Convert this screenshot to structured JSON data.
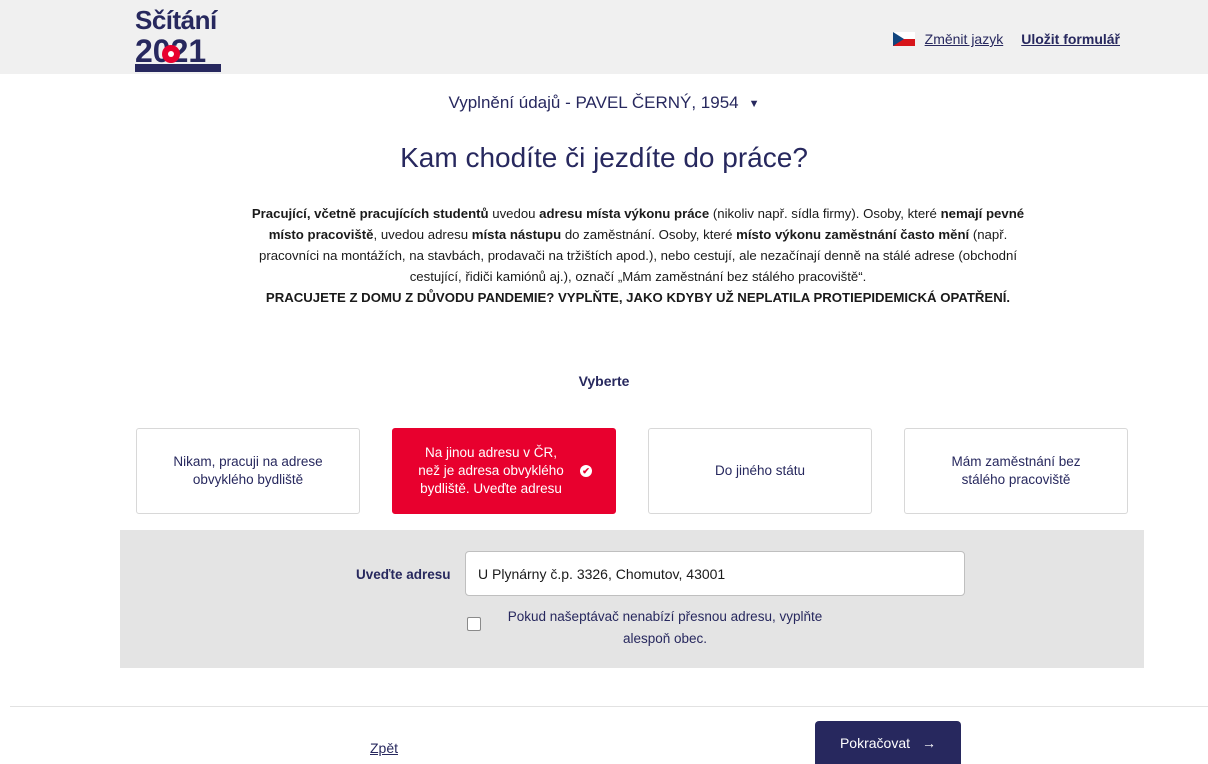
{
  "header": {
    "logo_text": "Sčítání",
    "logo_year": "2021",
    "change_language": "Změnit jazyk",
    "save_form": "Uložit formulář",
    "flag_icon": "czech-flag-icon"
  },
  "person_selector": {
    "label": "Vyplnění údajů - PAVEL ČERNÝ, 1954"
  },
  "question": {
    "title": "Kam chodíte či jezdíte do práce?",
    "description": {
      "p1_b1": "Pracující, včetně pracujících studentů",
      "p1_t1": " uvedou ",
      "p1_b2": "adresu místa výkonu práce",
      "p1_t2": " (nikoliv např. sídla firmy). Osoby, které ",
      "p1_b3": "nemají pevné místo pracoviště",
      "p1_t3": ", uvedou adresu ",
      "p1_b4": "místa nástupu",
      "p1_t4": " do zaměstnání. Osoby, které ",
      "p1_b5": "místo výkonu zaměstnání často mění",
      "p1_t5": " (např. pracovníci na montážích, na stavbách, prodavači na tržištích apod.), nebo cestují, ale nezačínají denně na stálé adrese (obchodní cestující, řidiči kamiónů aj.), označí „Mám zaměstnání bez stálého pracoviště“.",
      "p2": "PRACUJETE Z DOMU Z DŮVODU PANDEMIE? VYPLŇTE, JAKO KDYBY UŽ NEPLATILA PROTIEPIDEMICKÁ OPATŘENÍ."
    },
    "select_label": "Vyberte"
  },
  "options": [
    {
      "label": "Nikam, pracuji na adrese obvyklého bydliště",
      "selected": false
    },
    {
      "label": "Na jinou adresu v ČR, než je adresa obvyklého bydliště. Uveďte adresu",
      "selected": true
    },
    {
      "label": "Do jiného státu",
      "selected": false
    },
    {
      "label": "Mám zaměstnání bez stálého pracoviště",
      "selected": false
    }
  ],
  "address": {
    "label": "Uveďte adresu",
    "value": "U Plynárny č.p. 3326, Chomutov, 43001",
    "checkbox_label": "Pokud našeptávač nenabízí přesnou adresu, vyplňte alespoň obec.",
    "checkbox_checked": false
  },
  "footer": {
    "back": "Zpět",
    "continue": "Pokračovat"
  },
  "colors": {
    "brand_navy": "#27285e",
    "brand_red": "#e8002e",
    "panel_gray": "#e4e4e4"
  }
}
